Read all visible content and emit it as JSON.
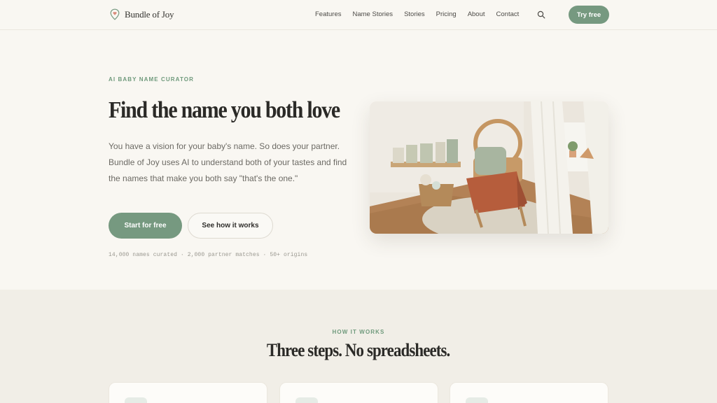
{
  "brand": {
    "name": "Bundle of Joy"
  },
  "nav": {
    "items": [
      "Features",
      "Name Stories",
      "Stories",
      "Pricing",
      "About",
      "Contact"
    ],
    "try_label": "Try free"
  },
  "hero": {
    "eyebrow": "AI BABY NAME CURATOR",
    "title": "Find the name you both love",
    "description": "You have a vision for your baby's name. So does your partner. Bundle of Joy uses AI to understand both of your tastes and find the names that make you both say \"that's the one.\"",
    "primary_cta": "Start for free",
    "secondary_cta": "See how it works",
    "stats": "14,000 names curated · 2,000 partner matches · 50+ origins"
  },
  "how": {
    "eyebrow": "HOW IT WORKS",
    "title": "Three steps. No spreadsheets."
  },
  "colors": {
    "accent": "#769980",
    "background": "#f9f7f2",
    "section_background": "#f1eee7"
  },
  "icons": [
    "pin-heart-icon",
    "search-icon"
  ]
}
